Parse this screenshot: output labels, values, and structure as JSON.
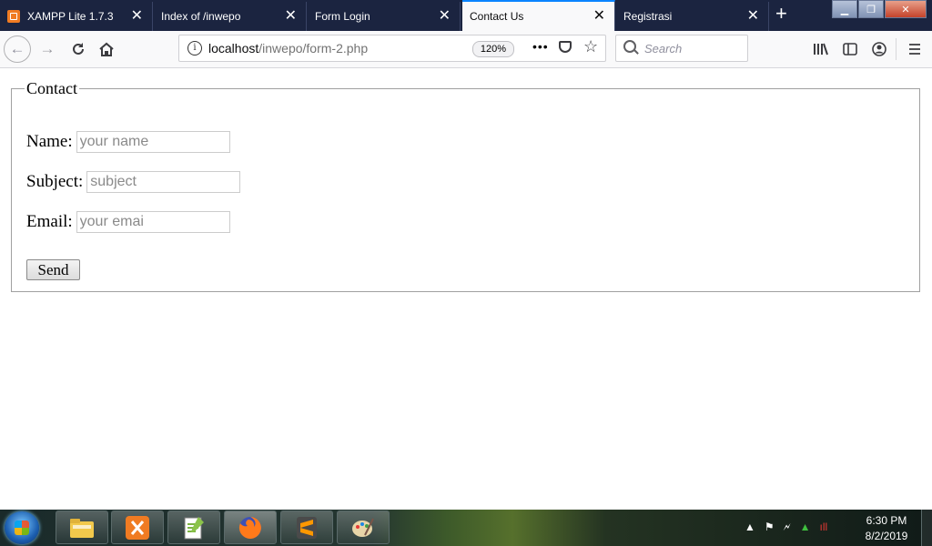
{
  "browser": {
    "tabs": [
      {
        "label": "XAMPP Lite 1.7.3",
        "active": false,
        "has_favicon": true
      },
      {
        "label": "Index of /inwepo",
        "active": false,
        "has_favicon": false
      },
      {
        "label": "Form Login",
        "active": false,
        "has_favicon": false
      },
      {
        "label": "Contact Us",
        "active": true,
        "has_favicon": false
      },
      {
        "label": "Registrasi",
        "active": false,
        "has_favicon": false
      }
    ],
    "new_tab_glyph": "+",
    "close_glyph": "✕",
    "url_host": "localhost",
    "url_path": "/inwepo/form-2.php",
    "zoom_level": "120%",
    "search_placeholder": "Search",
    "accent_color": "#0a84ff",
    "tabstrip_color": "#1b2440"
  },
  "page": {
    "legend": "Contact",
    "fields": [
      {
        "label": "Name:",
        "placeholder": "your name"
      },
      {
        "label": "Subject:",
        "placeholder": "subject"
      },
      {
        "label": "Email:",
        "placeholder": "your emai"
      }
    ],
    "send_label": "Send"
  },
  "taskbar": {
    "apps": [
      "file-explorer-icon",
      "xampp-icon",
      "notepad-plus-plus-icon",
      "firefox-icon",
      "sublime-text-icon",
      "paint-icon"
    ],
    "time": "6:30 PM",
    "date": "8/2/2019"
  }
}
